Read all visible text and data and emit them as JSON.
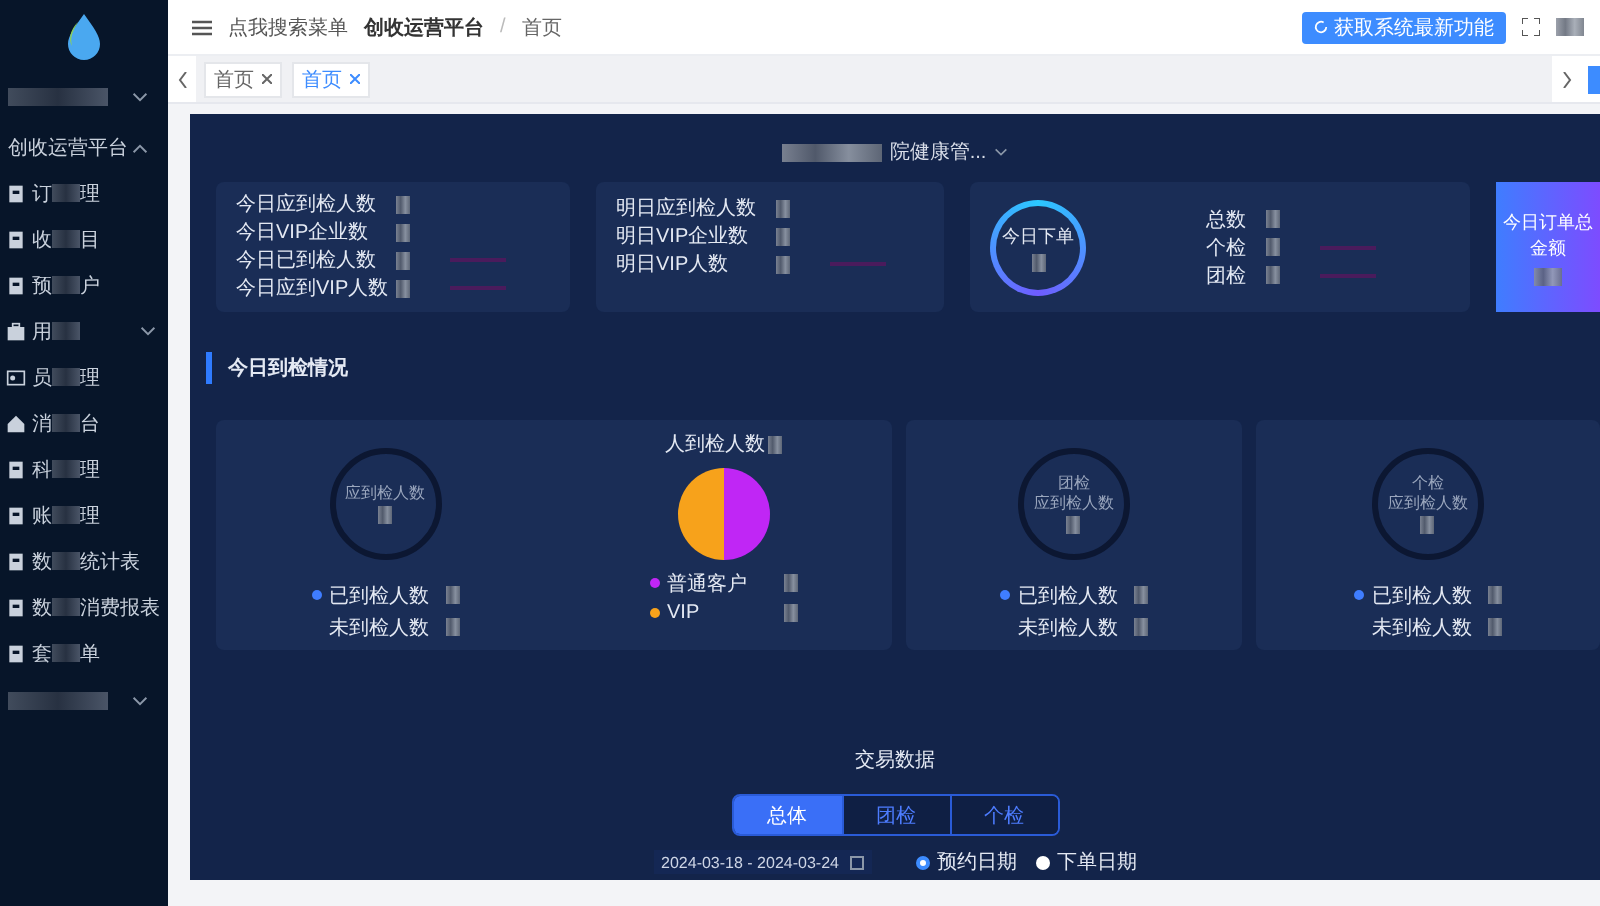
{
  "sidebar": {
    "account": {
      "expanded": false
    },
    "menu": {
      "label": "创收运营平台",
      "expanded": true,
      "children": [
        {
          "kind": "page",
          "text_start": "订",
          "text_end": "理"
        },
        {
          "kind": "page",
          "text_start": "收",
          "text_end": "目"
        },
        {
          "kind": "page",
          "text_start": "预",
          "text_end": "户"
        },
        {
          "kind": "folder",
          "text_start": "用",
          "expanded": false
        },
        {
          "kind": "card",
          "text_start": "员",
          "text_end": "理"
        },
        {
          "kind": "home",
          "text_start": "消",
          "text_end": "台"
        },
        {
          "kind": "page",
          "text_start": "科",
          "text_end": "理"
        },
        {
          "kind": "page",
          "text_start": "账",
          "text_end": "理"
        },
        {
          "kind": "page",
          "text_start": "数",
          "text_end": "统计表"
        },
        {
          "kind": "page",
          "text_start": "数",
          "text_end": "消费报表"
        },
        {
          "kind": "page",
          "text_start": "套",
          "text_end": "单"
        }
      ]
    },
    "bottom_group": {
      "expanded": false
    }
  },
  "header": {
    "search_hint": "点我搜索菜单",
    "breadcrumb": [
      "创收运营平台",
      "首页"
    ],
    "separator": "/",
    "update_button": "获取系统最新功能"
  },
  "tabs": [
    {
      "label": "首页",
      "selected": false
    },
    {
      "label": "首页",
      "selected": true
    }
  ],
  "org_select": {
    "value_end": "院健康管..."
  },
  "stat_cards": [
    {
      "kind": "list",
      "rows": [
        {
          "label": "今日应到检人数",
          "trend": false
        },
        {
          "label": "今日VIP企业数",
          "trend": false
        },
        {
          "label": "今日已到检人数",
          "trend": true
        },
        {
          "label": "今日应到VIP人数",
          "trend": true
        }
      ]
    },
    {
      "kind": "list",
      "rows": [
        {
          "label": "明日应到检人数",
          "trend": false
        },
        {
          "label": "明日VIP企业数",
          "trend": false
        },
        {
          "label": "明日VIP人数",
          "trend": true
        }
      ]
    },
    {
      "kind": "ring",
      "ring_label": "今日下单",
      "rows": [
        {
          "label": "总数",
          "trend": false
        },
        {
          "label": "个检",
          "trend": true
        },
        {
          "label": "团检",
          "trend": true
        }
      ]
    },
    {
      "kind": "highlight",
      "label": "今日订单总金额"
    }
  ],
  "section_title": "今日到检情况",
  "arrival_cards": [
    {
      "ring_label": "应到检人数",
      "legend": [
        {
          "label": "已到检人数",
          "marker": true
        },
        {
          "label": "未到检人数",
          "marker": false
        }
      ],
      "pie": {
        "title": "人到检人数",
        "legend": [
          {
            "label": "普通客户",
            "color": "#c026f5"
          },
          {
            "label": "VIP",
            "color": "#f7a21b"
          }
        ]
      }
    },
    {
      "ring_title": "团检",
      "ring_label": "应到检人数",
      "legend": [
        {
          "label": "已到检人数",
          "marker": true
        },
        {
          "label": "未到检人数",
          "marker": false
        }
      ]
    },
    {
      "ring_title": "个检",
      "ring_label": "应到检人数",
      "legend": [
        {
          "label": "已到检人数",
          "marker": true
        },
        {
          "label": "未到检人数",
          "marker": false
        }
      ]
    }
  ],
  "trade": {
    "title": "交易数据",
    "segments": [
      {
        "label": "总体",
        "selected": true
      },
      {
        "label": "团检",
        "selected": false
      },
      {
        "label": "个检",
        "selected": false
      }
    ],
    "date_range": "2024-03-18 - 2024-03-24",
    "date_types": [
      {
        "label": "预约日期",
        "selected": true
      },
      {
        "label": "下单日期",
        "selected": false
      }
    ]
  }
}
